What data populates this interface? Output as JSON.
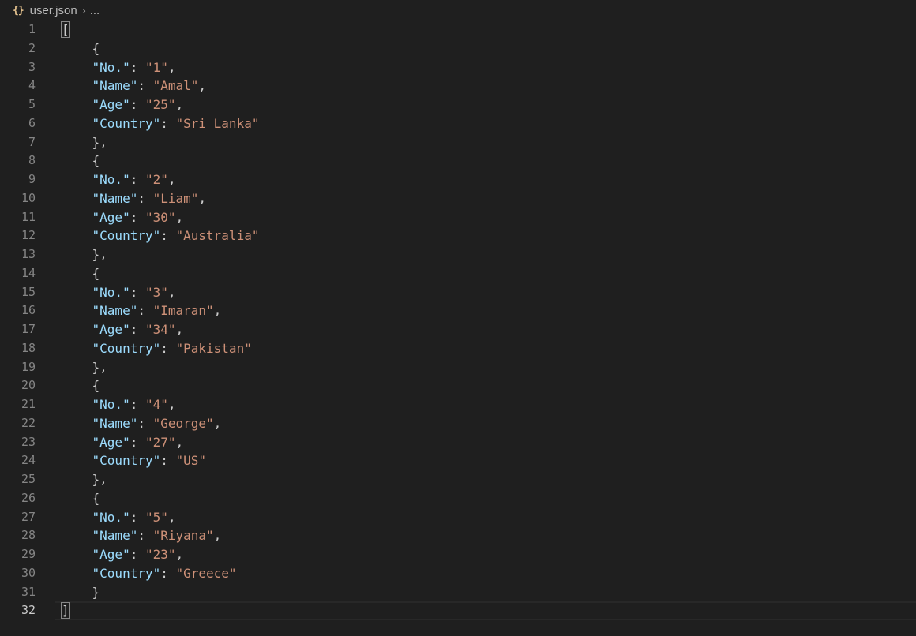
{
  "breadcrumb": {
    "icon": "{}",
    "file": "user.json",
    "separator": "›",
    "more": "..."
  },
  "lines": [
    {
      "n": "1",
      "indent": "",
      "segs": [
        [
          "bracket",
          "["
        ]
      ]
    },
    {
      "n": "2",
      "indent": "    ",
      "segs": [
        [
          "punc",
          "{"
        ]
      ]
    },
    {
      "n": "3",
      "indent": "    ",
      "segs": [
        [
          "key",
          "\"No.\""
        ],
        [
          "punc",
          ": "
        ],
        [
          "str",
          "\"1\""
        ],
        [
          "punc",
          ","
        ]
      ]
    },
    {
      "n": "4",
      "indent": "    ",
      "segs": [
        [
          "key",
          "\"Name\""
        ],
        [
          "punc",
          ": "
        ],
        [
          "str",
          "\"Amal\""
        ],
        [
          "punc",
          ","
        ]
      ]
    },
    {
      "n": "5",
      "indent": "    ",
      "segs": [
        [
          "key",
          "\"Age\""
        ],
        [
          "punc",
          ": "
        ],
        [
          "str",
          "\"25\""
        ],
        [
          "punc",
          ","
        ]
      ]
    },
    {
      "n": "6",
      "indent": "    ",
      "segs": [
        [
          "key",
          "\"Country\""
        ],
        [
          "punc",
          ": "
        ],
        [
          "str",
          "\"Sri Lanka\""
        ]
      ]
    },
    {
      "n": "7",
      "indent": "    ",
      "segs": [
        [
          "punc",
          "},"
        ]
      ]
    },
    {
      "n": "8",
      "indent": "    ",
      "segs": [
        [
          "punc",
          "{"
        ]
      ]
    },
    {
      "n": "9",
      "indent": "    ",
      "segs": [
        [
          "key",
          "\"No.\""
        ],
        [
          "punc",
          ": "
        ],
        [
          "str",
          "\"2\""
        ],
        [
          "punc",
          ","
        ]
      ]
    },
    {
      "n": "10",
      "indent": "    ",
      "segs": [
        [
          "key",
          "\"Name\""
        ],
        [
          "punc",
          ": "
        ],
        [
          "str",
          "\"Liam\""
        ],
        [
          "punc",
          ","
        ]
      ]
    },
    {
      "n": "11",
      "indent": "    ",
      "segs": [
        [
          "key",
          "\"Age\""
        ],
        [
          "punc",
          ": "
        ],
        [
          "str",
          "\"30\""
        ],
        [
          "punc",
          ","
        ]
      ]
    },
    {
      "n": "12",
      "indent": "    ",
      "segs": [
        [
          "key",
          "\"Country\""
        ],
        [
          "punc",
          ": "
        ],
        [
          "str",
          "\"Australia\""
        ]
      ]
    },
    {
      "n": "13",
      "indent": "    ",
      "segs": [
        [
          "punc",
          "},"
        ]
      ]
    },
    {
      "n": "14",
      "indent": "    ",
      "segs": [
        [
          "punc",
          "{"
        ]
      ]
    },
    {
      "n": "15",
      "indent": "    ",
      "segs": [
        [
          "key",
          "\"No.\""
        ],
        [
          "punc",
          ": "
        ],
        [
          "str",
          "\"3\""
        ],
        [
          "punc",
          ","
        ]
      ]
    },
    {
      "n": "16",
      "indent": "    ",
      "segs": [
        [
          "key",
          "\"Name\""
        ],
        [
          "punc",
          ": "
        ],
        [
          "str",
          "\"Imaran\""
        ],
        [
          "punc",
          ","
        ]
      ]
    },
    {
      "n": "17",
      "indent": "    ",
      "segs": [
        [
          "key",
          "\"Age\""
        ],
        [
          "punc",
          ": "
        ],
        [
          "str",
          "\"34\""
        ],
        [
          "punc",
          ","
        ]
      ]
    },
    {
      "n": "18",
      "indent": "    ",
      "segs": [
        [
          "key",
          "\"Country\""
        ],
        [
          "punc",
          ": "
        ],
        [
          "str",
          "\"Pakistan\""
        ]
      ]
    },
    {
      "n": "19",
      "indent": "    ",
      "segs": [
        [
          "punc",
          "},"
        ]
      ]
    },
    {
      "n": "20",
      "indent": "    ",
      "segs": [
        [
          "punc",
          "{"
        ]
      ]
    },
    {
      "n": "21",
      "indent": "    ",
      "segs": [
        [
          "key",
          "\"No.\""
        ],
        [
          "punc",
          ": "
        ],
        [
          "str",
          "\"4\""
        ],
        [
          "punc",
          ","
        ]
      ]
    },
    {
      "n": "22",
      "indent": "    ",
      "segs": [
        [
          "key",
          "\"Name\""
        ],
        [
          "punc",
          ": "
        ],
        [
          "str",
          "\"George\""
        ],
        [
          "punc",
          ","
        ]
      ]
    },
    {
      "n": "23",
      "indent": "    ",
      "segs": [
        [
          "key",
          "\"Age\""
        ],
        [
          "punc",
          ": "
        ],
        [
          "str",
          "\"27\""
        ],
        [
          "punc",
          ","
        ]
      ]
    },
    {
      "n": "24",
      "indent": "    ",
      "segs": [
        [
          "key",
          "\"Country\""
        ],
        [
          "punc",
          ": "
        ],
        [
          "str",
          "\"US\""
        ]
      ]
    },
    {
      "n": "25",
      "indent": "    ",
      "segs": [
        [
          "punc",
          "},"
        ]
      ]
    },
    {
      "n": "26",
      "indent": "    ",
      "segs": [
        [
          "punc",
          "{"
        ]
      ]
    },
    {
      "n": "27",
      "indent": "    ",
      "segs": [
        [
          "key",
          "\"No.\""
        ],
        [
          "punc",
          ": "
        ],
        [
          "str",
          "\"5\""
        ],
        [
          "punc",
          ","
        ]
      ]
    },
    {
      "n": "28",
      "indent": "    ",
      "segs": [
        [
          "key",
          "\"Name\""
        ],
        [
          "punc",
          ": "
        ],
        [
          "str",
          "\"Riyana\""
        ],
        [
          "punc",
          ","
        ]
      ]
    },
    {
      "n": "29",
      "indent": "    ",
      "segs": [
        [
          "key",
          "\"Age\""
        ],
        [
          "punc",
          ": "
        ],
        [
          "str",
          "\"23\""
        ],
        [
          "punc",
          ","
        ]
      ]
    },
    {
      "n": "30",
      "indent": "    ",
      "segs": [
        [
          "key",
          "\"Country\""
        ],
        [
          "punc",
          ": "
        ],
        [
          "str",
          "\"Greece\""
        ]
      ]
    },
    {
      "n": "31",
      "indent": "    ",
      "segs": [
        [
          "punc",
          "}"
        ]
      ]
    },
    {
      "n": "32",
      "indent": "",
      "segs": [
        [
          "bracket",
          "]"
        ]
      ]
    }
  ],
  "active_line": "32",
  "colors": {
    "background": "#1f1f1f",
    "key": "#9cdcfe",
    "string": "#ce9178",
    "line_number": "#858585",
    "json_icon": "#e2c08d"
  }
}
